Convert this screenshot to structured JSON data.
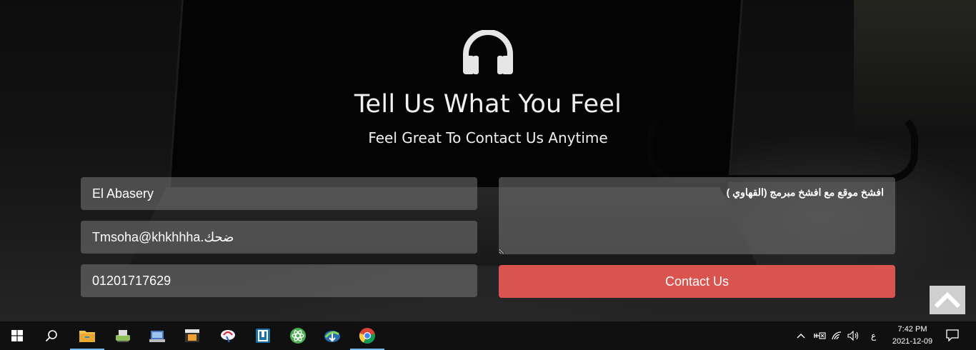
{
  "hero": {
    "title": "Tell Us What You Feel",
    "subtitle": "Feel Great To Contact Us Anytime",
    "icon": "headphones-icon"
  },
  "form": {
    "name_value": "El Abasery",
    "email_value": "Tmsoha@khkhhha.ضحك",
    "phone_value": "01201717629",
    "message_value": "افشخ موقع مع افشخ مبرمج (القهاوي )",
    "submit_label": "Contact Us"
  },
  "scroll_top": {
    "icon": "chevron-up-icon"
  },
  "taskbar": {
    "apps": [
      "start-icon",
      "search-icon",
      "file-explorer-icon",
      "app-icon",
      "app-icon",
      "app-icon",
      "app-icon",
      "app-icon",
      "atom-icon",
      "app-icon",
      "chrome-icon"
    ],
    "tray": {
      "language": "ع",
      "time": "7:42 PM",
      "date": "2021-12-09"
    }
  },
  "colors": {
    "accent": "#d9534f",
    "taskbar": "#101010",
    "field_bg": "#787878"
  }
}
